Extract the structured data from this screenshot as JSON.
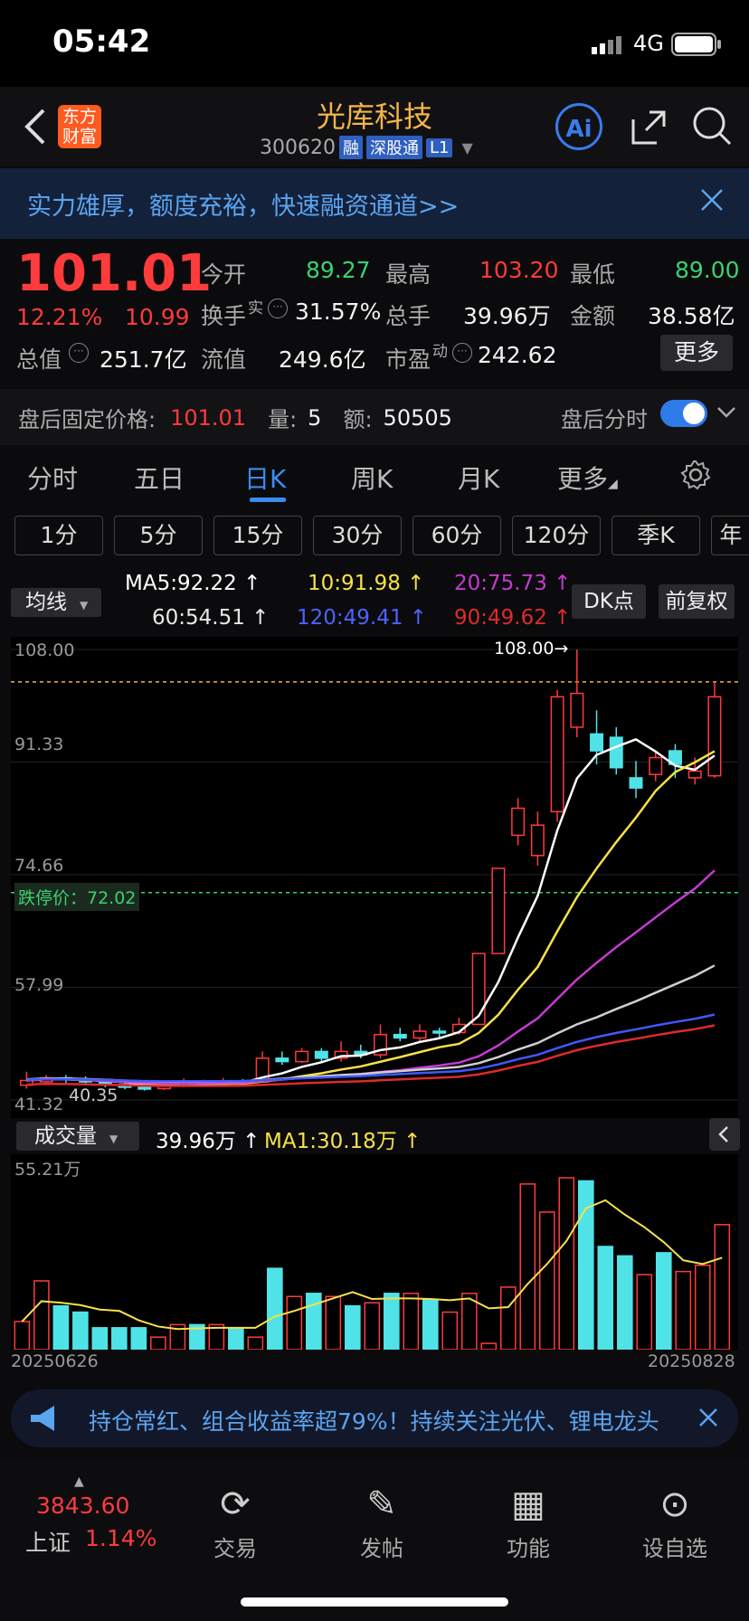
{
  "status": {
    "time": "05:42",
    "network": "4G"
  },
  "header": {
    "name": "光库科技",
    "code": "300620",
    "tags": [
      "融",
      "深股通",
      "L1"
    ],
    "logo_text": "东方财富",
    "ai_label": "Ai"
  },
  "banner": {
    "text": "实力雄厚，额度充裕，快速融资通道>>"
  },
  "quote": {
    "price": "101.01",
    "change_pct": "12.21%",
    "change": "10.99",
    "open_label": "今开",
    "open": "89.27",
    "high_label": "最高",
    "high": "103.20",
    "low_label": "最低",
    "low": "89.00",
    "turnover_label": "换手",
    "turnover_sup": "实",
    "turnover": "31.57%",
    "volume_label": "总手",
    "volume": "39.96万",
    "amount_label": "金额",
    "amount": "38.58亿",
    "mktcap_label": "总值",
    "mktcap": "251.7亿",
    "float_label": "流值",
    "float": "249.6亿",
    "pe_label": "市盈",
    "pe_sup": "动",
    "pe": "242.62",
    "more": "更多"
  },
  "after_hours": {
    "label": "盘后固定价格:",
    "price": "101.01",
    "vol_label": "量:",
    "vol": "5",
    "amt_label": "额:",
    "amt": "50505",
    "toggle_label": "盘后分时"
  },
  "tabs": [
    "分时",
    "五日",
    "日K",
    "周K",
    "月K",
    "更多"
  ],
  "active_tab": "日K",
  "subtabs": [
    "1分",
    "5分",
    "15分",
    "30分",
    "60分",
    "120分",
    "季K",
    "年"
  ],
  "ma": {
    "selector": "均线",
    "ma5": "MA5:92.22",
    "ma10": "10:91.98",
    "ma20": "20:75.73",
    "ma60": "60:54.51",
    "ma120": "120:49.41",
    "ma90": "90:49.62",
    "dk": "DK点",
    "adjust": "前复权"
  },
  "colors": {
    "up": "#ff3b3b",
    "down": "#4fe3e8",
    "ma5": "#ffffff",
    "ma10": "#f6e14a",
    "ma20": "#c43bd1",
    "ma60": "#cfcfcf",
    "ma120": "#4059ff",
    "ma90": "#e02a2a"
  },
  "chart_data": {
    "type": "candlestick",
    "y_labels": [
      "108.00",
      "91.33",
      "74.66",
      "57.99",
      "41.32"
    ],
    "limit_label": "跌停价：72.02",
    "high_mark": "108.00→",
    "low_mark": "40.35",
    "ylim": [
      41.32,
      108.0
    ],
    "candles": [
      {
        "o": 43.5,
        "c": 44.2,
        "h": 45.5,
        "l": 43.0
      },
      {
        "o": 44.0,
        "c": 44.6,
        "h": 45.0,
        "l": 43.5
      },
      {
        "o": 44.6,
        "c": 44.3,
        "h": 45.0,
        "l": 43.8
      },
      {
        "o": 44.3,
        "c": 44.0,
        "h": 44.8,
        "l": 43.7
      },
      {
        "o": 44.0,
        "c": 43.6,
        "h": 44.4,
        "l": 43.2
      },
      {
        "o": 43.6,
        "c": 43.2,
        "h": 43.9,
        "l": 42.9
      },
      {
        "o": 43.2,
        "c": 43.0,
        "h": 43.5,
        "l": 42.7
      },
      {
        "o": 43.0,
        "c": 43.4,
        "h": 43.8,
        "l": 42.8
      },
      {
        "o": 43.4,
        "c": 44.0,
        "h": 44.5,
        "l": 43.2
      },
      {
        "o": 44.0,
        "c": 43.7,
        "h": 44.3,
        "l": 43.4
      },
      {
        "o": 43.7,
        "c": 44.1,
        "h": 44.6,
        "l": 43.5
      },
      {
        "o": 44.1,
        "c": 44.0,
        "h": 44.4,
        "l": 43.8
      },
      {
        "o": 44.0,
        "c": 47.5,
        "h": 48.5,
        "l": 44.0
      },
      {
        "o": 47.5,
        "c": 47.0,
        "h": 48.5,
        "l": 46.5
      },
      {
        "o": 47.0,
        "c": 48.5,
        "h": 49.0,
        "l": 46.8
      },
      {
        "o": 48.5,
        "c": 47.5,
        "h": 49.0,
        "l": 47.0
      },
      {
        "o": 47.5,
        "c": 48.5,
        "h": 50.0,
        "l": 47.0
      },
      {
        "o": 48.5,
        "c": 48.0,
        "h": 49.5,
        "l": 47.5
      },
      {
        "o": 48.0,
        "c": 51.0,
        "h": 52.5,
        "l": 47.5
      },
      {
        "o": 51.0,
        "c": 50.5,
        "h": 52.0,
        "l": 50.0
      },
      {
        "o": 50.5,
        "c": 51.5,
        "h": 52.5,
        "l": 50.0
      },
      {
        "o": 51.5,
        "c": 51.3,
        "h": 52.0,
        "l": 50.5
      },
      {
        "o": 51.3,
        "c": 52.5,
        "h": 53.5,
        "l": 51.0
      },
      {
        "o": 52.5,
        "c": 63.0,
        "h": 63.0,
        "l": 52.5
      },
      {
        "o": 63.0,
        "c": 75.6,
        "h": 75.6,
        "l": 63.0
      },
      {
        "o": 80.5,
        "c": 84.5,
        "h": 86.0,
        "l": 79.0
      },
      {
        "o": 77.5,
        "c": 82.0,
        "h": 84.0,
        "l": 76.0
      },
      {
        "o": 84.0,
        "c": 101.0,
        "h": 102.0,
        "l": 82.5
      },
      {
        "o": 96.5,
        "c": 101.5,
        "h": 108.0,
        "l": 95.0
      },
      {
        "o": 95.5,
        "c": 93.0,
        "h": 99.0,
        "l": 91.0
      },
      {
        "o": 95.0,
        "c": 90.5,
        "h": 96.5,
        "l": 89.5
      },
      {
        "o": 89.0,
        "c": 87.5,
        "h": 91.5,
        "l": 86.0
      },
      {
        "o": 89.5,
        "c": 92.0,
        "h": 93.0,
        "l": 88.5
      },
      {
        "o": 93.0,
        "c": 91.0,
        "h": 94.0,
        "l": 89.0
      },
      {
        "o": 89.0,
        "c": 90.0,
        "h": 92.0,
        "l": 88.0
      },
      {
        "o": 89.3,
        "c": 101.0,
        "h": 103.2,
        "l": 89.0
      }
    ],
    "volume": {
      "label": "成交量",
      "value": "39.96万",
      "ma1": "MA1:30.18万",
      "max_label": "55.21万",
      "start_date": "20250626",
      "end_date": "20250828",
      "ma1_color": "#f6e14a",
      "bars": [
        9,
        22,
        14,
        12,
        7,
        7,
        7,
        4,
        8,
        8,
        8,
        7,
        4,
        26,
        17,
        18,
        17,
        14,
        15,
        18,
        18,
        16,
        12,
        18,
        2,
        20,
        53,
        44,
        55,
        54,
        33,
        30,
        24,
        31,
        25,
        27,
        40
      ]
    }
  },
  "bottom_ad": {
    "text": "持仓常红、组合收益率超79%！持续关注光伏、锂电龙头"
  },
  "nav": {
    "index_value": "3843.60",
    "index_name": "上证",
    "index_pct": "1.14%",
    "items": [
      "交易",
      "发帖",
      "功能",
      "设自选"
    ]
  }
}
